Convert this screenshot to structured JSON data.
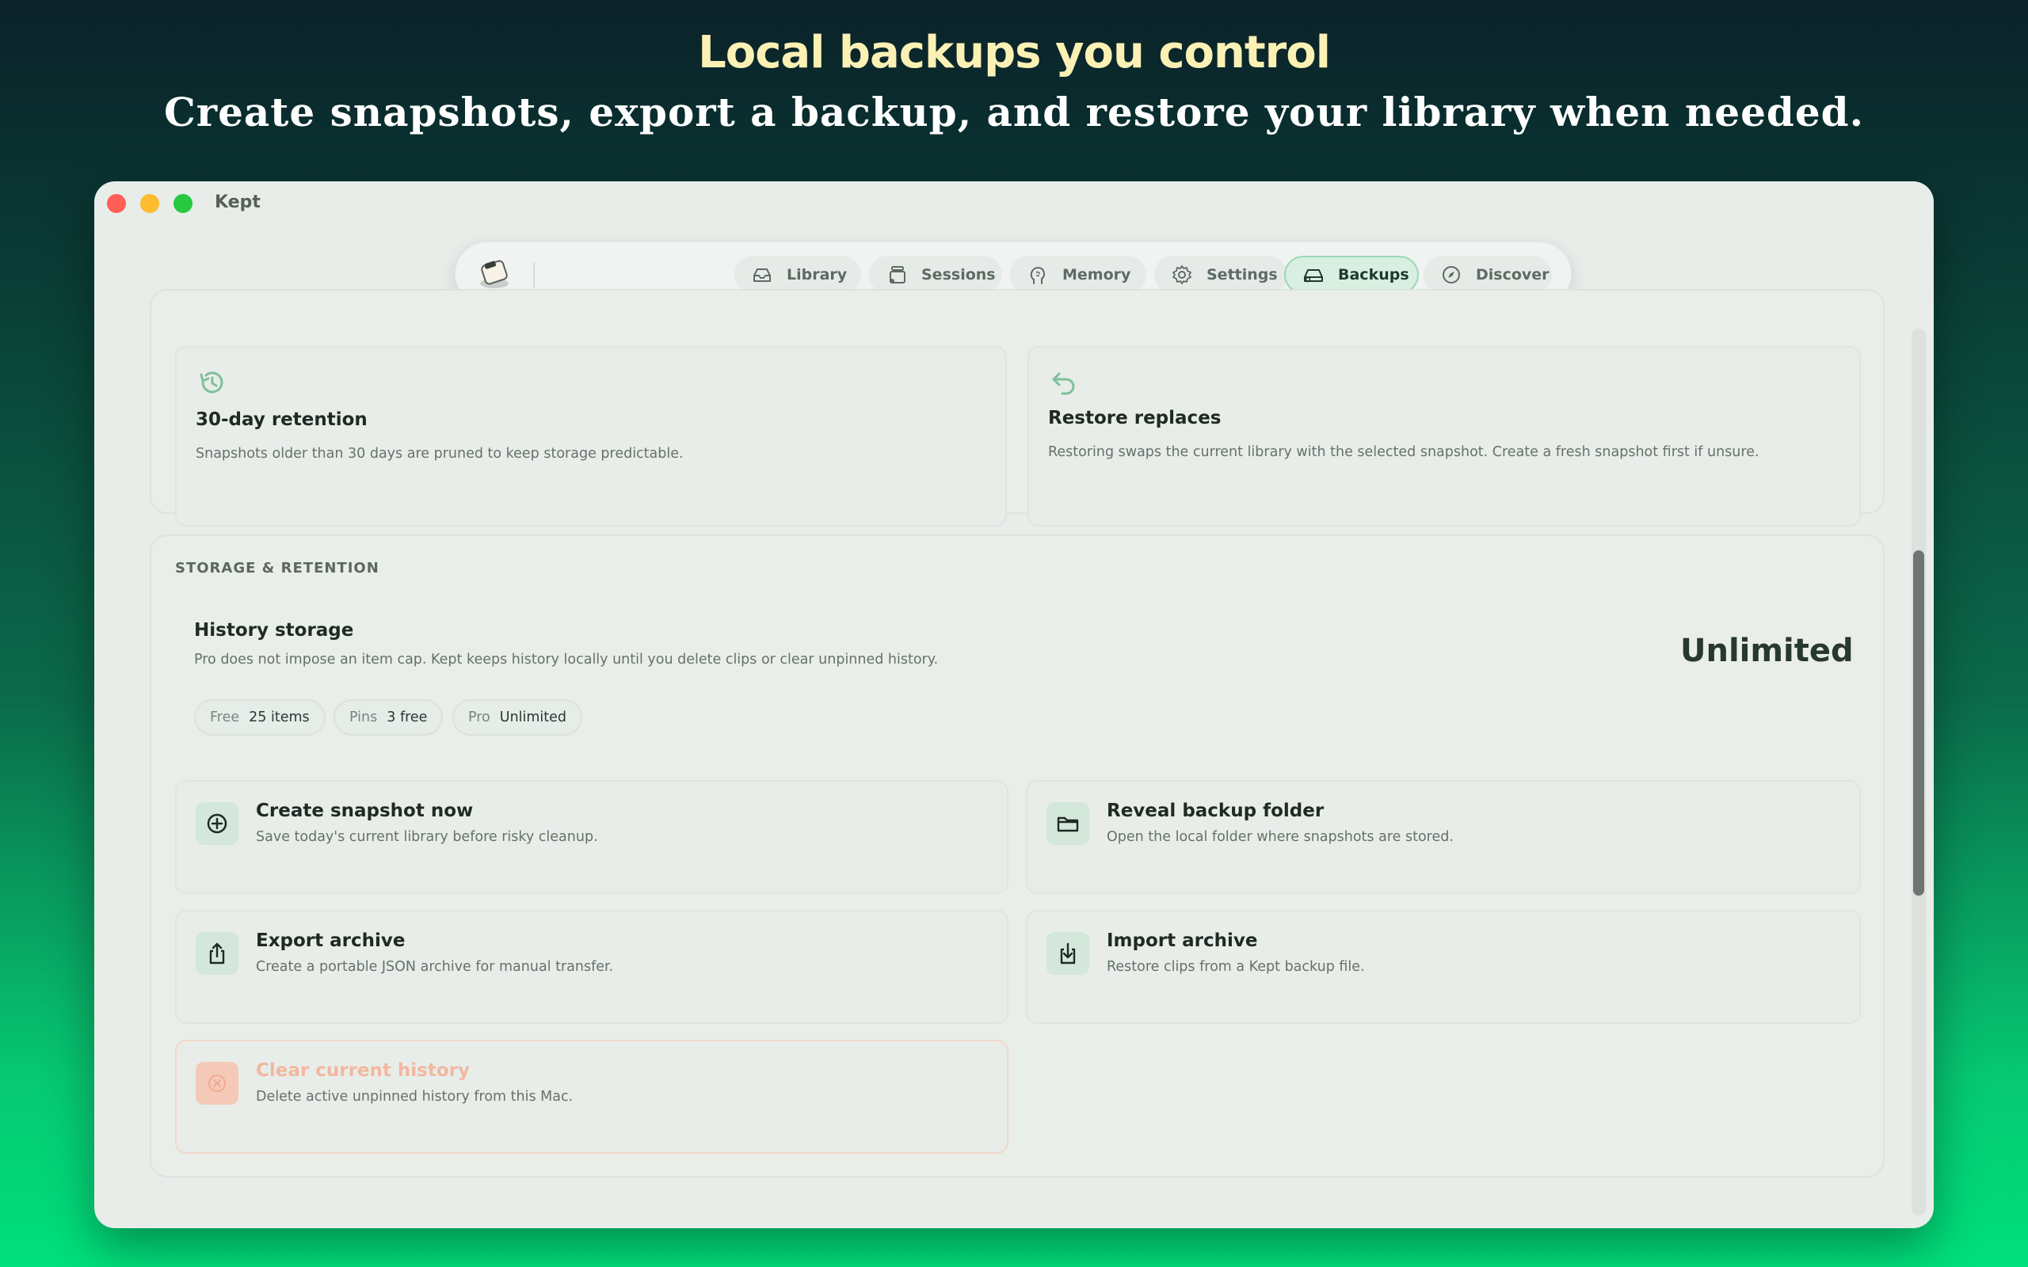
{
  "hero": {
    "title": "Local backups you control",
    "subtitle": "Create snapshots, export a backup, and restore your library when needed."
  },
  "window": {
    "title": "Kept"
  },
  "nav": {
    "tabs": [
      {
        "label": "Library",
        "icon": "tray-icon"
      },
      {
        "label": "Sessions",
        "icon": "sessions-icon"
      },
      {
        "label": "Memory",
        "icon": "brain-icon"
      },
      {
        "label": "Settings",
        "icon": "gear-icon"
      },
      {
        "label": "Backups",
        "icon": "drive-icon",
        "active": true
      },
      {
        "label": "Discover",
        "icon": "compass-icon"
      }
    ]
  },
  "info_cards": {
    "retention": {
      "title": "30-day retention",
      "desc": "Snapshots older than 30 days are pruned to keep storage predictable.",
      "icon": "history-icon"
    },
    "restore": {
      "title": "Restore replaces",
      "desc": "Restoring swaps the current library with the selected snapshot. Create a fresh snapshot first if unsure.",
      "icon": "undo-arrow-icon"
    }
  },
  "storage": {
    "section_label": "STORAGE & RETENTION",
    "history_title": "History storage",
    "history_desc": "Pro does not impose an item cap. Kept keeps history locally until you delete clips or clear unpinned history.",
    "value": "Unlimited",
    "chips": [
      {
        "key": "Free",
        "value": "25 items"
      },
      {
        "key": "Pins",
        "value": "3 free"
      },
      {
        "key": "Pro",
        "value": "Unlimited"
      }
    ]
  },
  "actions": {
    "create": {
      "title": "Create snapshot now",
      "desc": "Save today's current library before risky cleanup.",
      "icon": "plus-circle-icon"
    },
    "reveal": {
      "title": "Reveal backup folder",
      "desc": "Open the local folder where snapshots are stored.",
      "icon": "folder-icon"
    },
    "export": {
      "title": "Export archive",
      "desc": "Create a portable JSON archive for manual transfer.",
      "icon": "share-icon"
    },
    "import": {
      "title": "Import archive",
      "desc": "Restore clips from a Kept backup file.",
      "icon": "download-icon"
    },
    "clear": {
      "title": "Clear current history",
      "desc": "Delete active unpinned history from this Mac.",
      "icon": "clear-icon"
    }
  },
  "colors": {
    "accent": "#2f7a52",
    "danger": "#f3a78f",
    "hero_title": "#fbf1b4"
  }
}
